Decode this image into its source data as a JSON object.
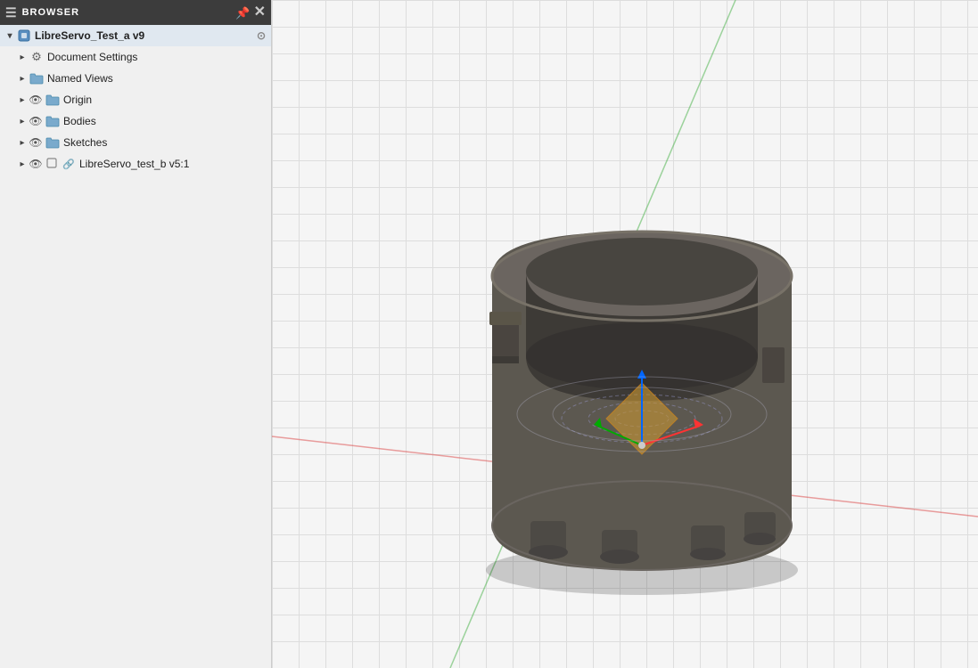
{
  "browser": {
    "header_label": "BROWSER",
    "expand_all_icon": "expand-all",
    "collapse_icon": "collapse",
    "pin_icon": "pin",
    "close_icon": "close"
  },
  "tree": {
    "root": {
      "label": "LibreServo_Test_a v9",
      "icon": "component",
      "expanded": true
    },
    "items": [
      {
        "id": "document-settings",
        "label": "Document Settings",
        "icon": "gear",
        "indent": 1,
        "has_expand": true,
        "expanded": false,
        "has_eye": false
      },
      {
        "id": "named-views",
        "label": "Named Views",
        "icon": "folder",
        "indent": 1,
        "has_expand": true,
        "expanded": false,
        "has_eye": false
      },
      {
        "id": "origin",
        "label": "Origin",
        "icon": "folder",
        "indent": 1,
        "has_expand": true,
        "expanded": false,
        "has_eye": true
      },
      {
        "id": "bodies",
        "label": "Bodies",
        "icon": "folder",
        "indent": 1,
        "has_expand": true,
        "expanded": false,
        "has_eye": true
      },
      {
        "id": "sketches",
        "label": "Sketches",
        "icon": "folder",
        "indent": 1,
        "has_expand": true,
        "expanded": false,
        "has_eye": true
      },
      {
        "id": "libreservo-b",
        "label": "LibreServo_test_b v5:1",
        "icon": "link",
        "indent": 1,
        "has_expand": true,
        "expanded": false,
        "has_eye": true
      }
    ]
  },
  "viewport": {
    "background_color": "#f0f0f0"
  }
}
